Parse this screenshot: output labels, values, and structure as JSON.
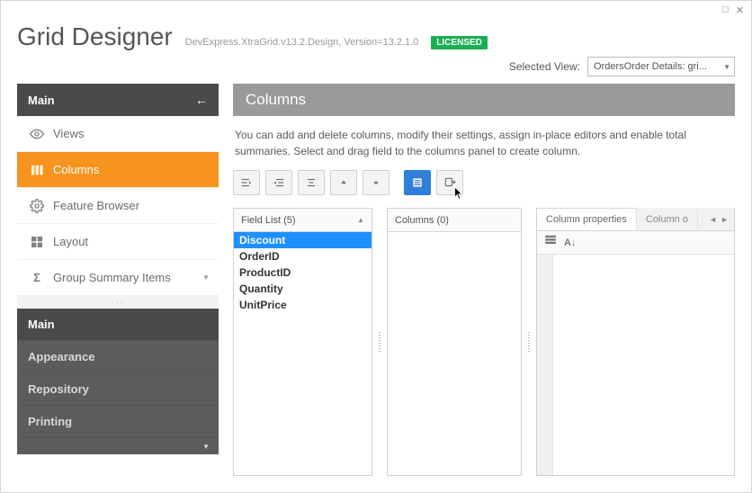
{
  "window": {
    "title": "Grid Designer",
    "assembly": "DevExpress.XtraGrid.v13.2.Design, Version=13.2.1.0",
    "license_badge": "LICENSED"
  },
  "header": {
    "selected_view_label": "Selected View:",
    "selected_view_value": "OrdersOrder Details: gri..."
  },
  "sidebar": {
    "section_main": "Main",
    "items": [
      {
        "key": "views",
        "label": "Views"
      },
      {
        "key": "columns",
        "label": "Columns"
      },
      {
        "key": "feature-browser",
        "label": "Feature Browser"
      },
      {
        "key": "layout",
        "label": "Layout"
      },
      {
        "key": "group-summary",
        "label": "Group Summary Items"
      }
    ],
    "sections": [
      {
        "key": "main2",
        "label": "Main"
      },
      {
        "key": "appearance",
        "label": "Appearance"
      },
      {
        "key": "repository",
        "label": "Repository"
      },
      {
        "key": "printing",
        "label": "Printing"
      }
    ]
  },
  "page": {
    "title": "Columns",
    "description": "You can add and delete columns, modify their settings, assign in-place editors and enable total summaries. Select and drag field to the columns panel to create column."
  },
  "toolbar": {
    "buttons": [
      "indent-left",
      "indent-right",
      "indent-both",
      "move-up",
      "move-down",
      "show-fields",
      "retrieve-fields"
    ]
  },
  "field_list": {
    "header": "Field List (5)",
    "items": [
      "Discount",
      "OrderID",
      "ProductID",
      "Quantity",
      "UnitPrice"
    ],
    "selected": "Discount"
  },
  "columns_panel": {
    "header": "Columns (0)"
  },
  "props_panel": {
    "tabs": [
      "Column properties",
      "Column o"
    ],
    "active_tab": 0
  }
}
